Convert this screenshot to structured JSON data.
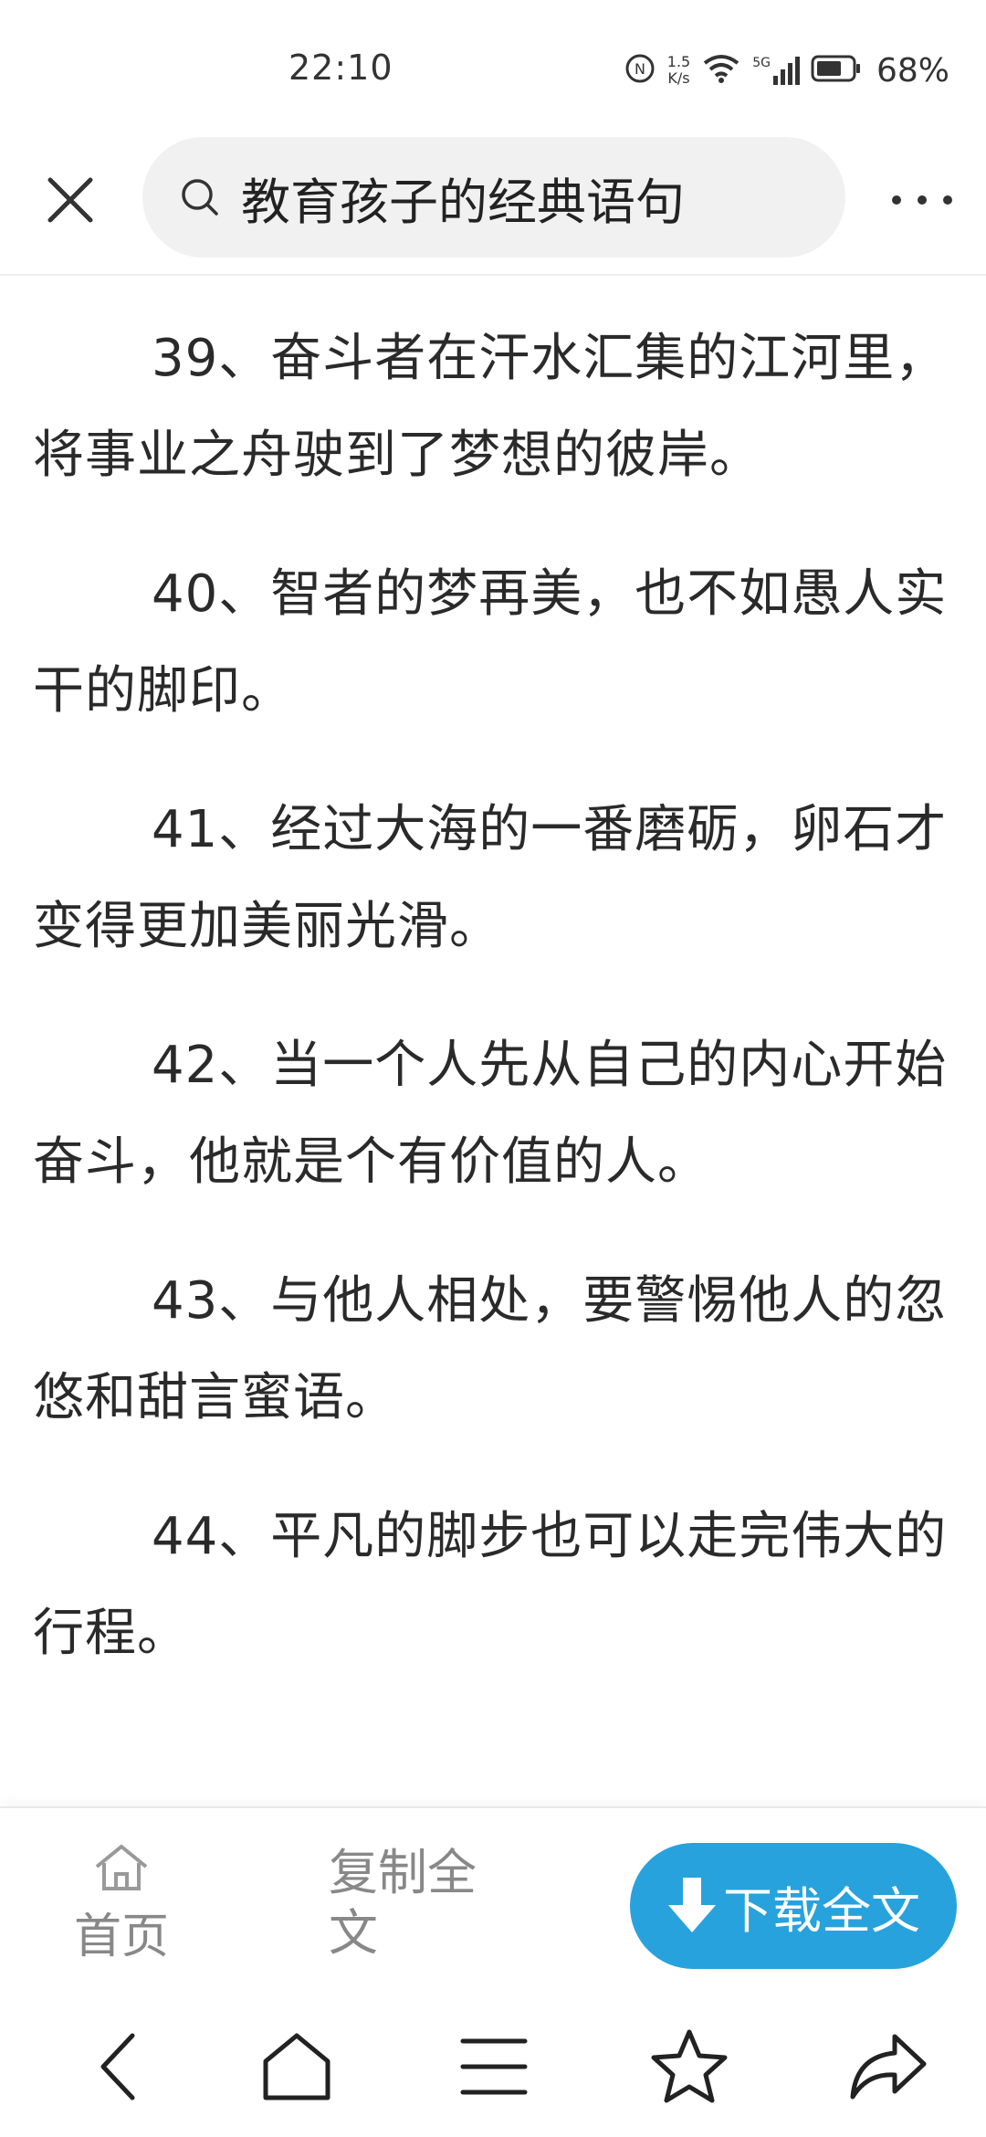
{
  "status_bar": {
    "time": "22:10",
    "net_speed_value": "1.5",
    "net_speed_unit": "K/s",
    "signal_label": "5G",
    "battery_percent": "68%"
  },
  "top_bar": {
    "search_query": "教育孩子的经典语句"
  },
  "article": {
    "paragraphs": [
      "39、奋斗者在汗水汇集的江河里，将事业之舟驶到了梦想的彼岸。",
      "40、智者的梦再美，也不如愚人实干的脚印。",
      "41、经过大海的一番磨砺，卵石才变得更加美丽光滑。",
      "42、当一个人先从自己的内心开始奋斗，他就是个有价值的人。",
      "43、与他人相处，要警惕他人的忽悠和甜言蜜语。",
      "44、平凡的脚步也可以走完伟大的行程。"
    ]
  },
  "action_bar": {
    "home_label": "首页",
    "copy_label": "复制全文",
    "download_label": "下载全文"
  },
  "colors": {
    "accent": "#27a2dd",
    "muted_text": "#888888"
  }
}
